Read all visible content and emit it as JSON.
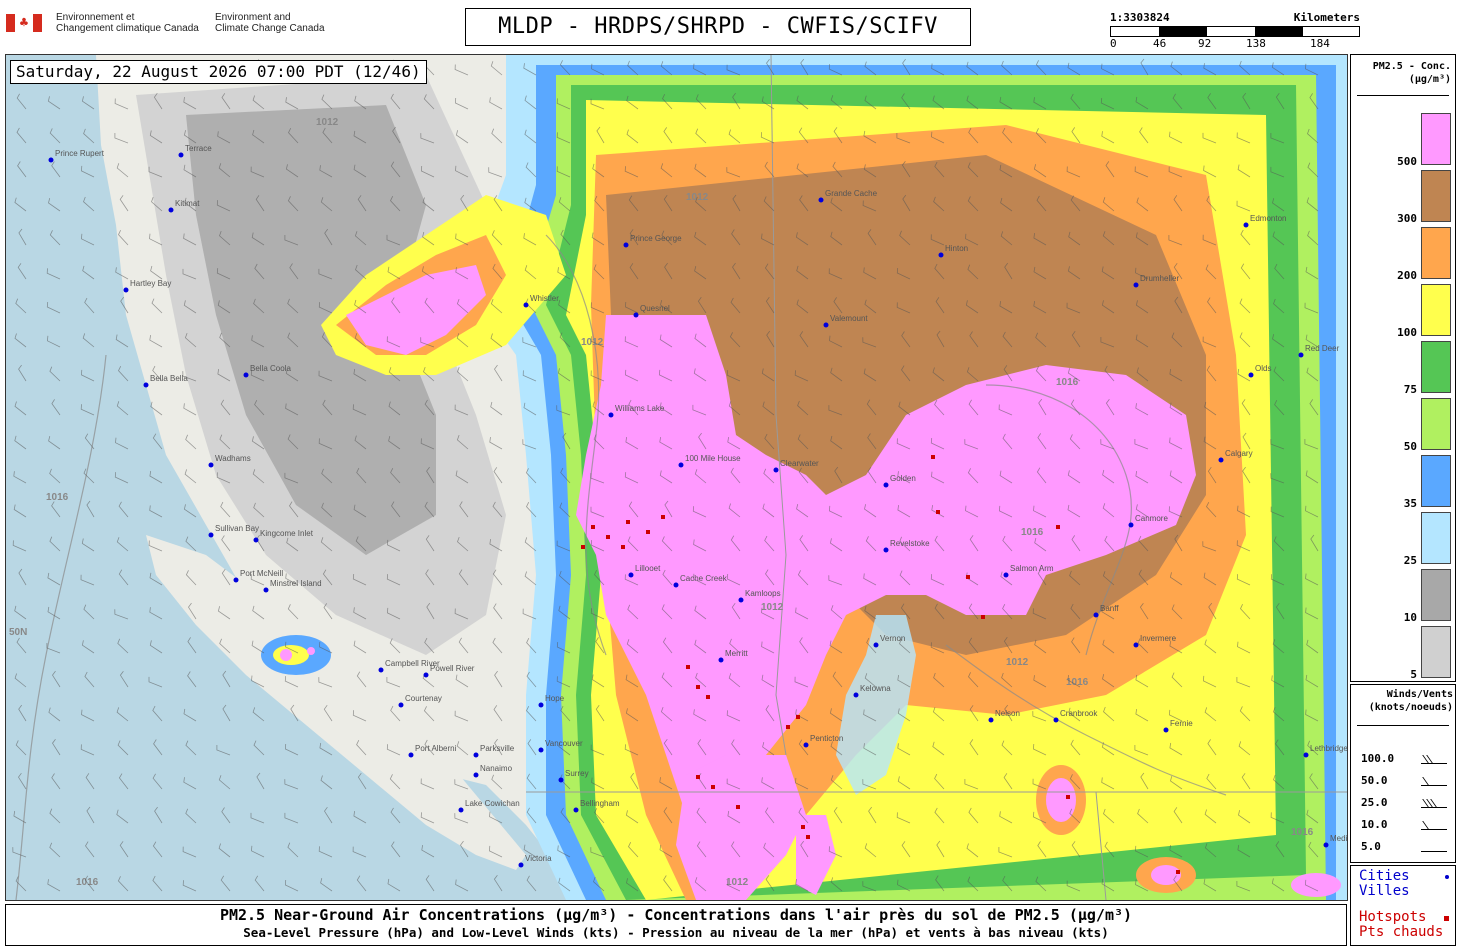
{
  "header": {
    "dept_fr": [
      "Environnement et",
      "Changement climatique Canada"
    ],
    "dept_en": [
      "Environment and",
      "Climate Change Canada"
    ],
    "title": "MLDP - HRDPS/SHRPD - CWFIS/SCIFV"
  },
  "scale": {
    "ratio": "1:3303824",
    "unit": "Kilometers",
    "ticks": [
      "0",
      "46",
      "92",
      "138",
      "184"
    ]
  },
  "map": {
    "timestamp": "Saturday, 22 August 2026 07:00 PDT (12/46)",
    "isobar_labels": [
      "1012",
      "1012",
      "1012",
      "1016",
      "1016",
      "1016",
      "1016",
      "1012",
      "1012",
      "1016",
      "1016",
      "1012"
    ],
    "lat_label": "50N",
    "cities": [
      "Prince Rupert",
      "Terrace",
      "Kitimat",
      "Hartley Bay",
      "Bella Bella",
      "Bella Coola",
      "Wadhams",
      "Port McNeill",
      "Campbell River",
      "Courtenay",
      "Nanaimo",
      "Lake Cowichan",
      "Victoria",
      "Vancouver",
      "Surrey",
      "Bellingham",
      "Kamloops",
      "Merritt",
      "Cache Creek",
      "Clearwater",
      "Williams Lake",
      "100 Mile House",
      "Valemount",
      "Revelstoke",
      "Nelson",
      "Cranbrook",
      "Fernie",
      "Golden",
      "Canmore",
      "Calgary",
      "Red Deer",
      "Edmonton",
      "Hinton",
      "Grande Cache",
      "Prince George",
      "Quesnel",
      "Lillooet",
      "Hope",
      "Penticton",
      "Kelowna",
      "Vernon",
      "Salmon Arm",
      "Banff",
      "Invermere",
      "Lethbridge",
      "Medicine Hat",
      "Drumheller",
      "Olds",
      "Whistler",
      "Powell River",
      "Parksville",
      "Sullivan Bay",
      "Kingcome Inlet",
      "Minstrel Island",
      "Port Alberni"
    ],
    "hotspots_count": 24
  },
  "legend": {
    "title": [
      "PM2.5 - Conc.",
      "(µg/m³)"
    ],
    "levels": [
      {
        "value": "500",
        "color": "#ff99ff"
      },
      {
        "value": "300",
        "color": "#bf8552"
      },
      {
        "value": "200",
        "color": "#ffa64d"
      },
      {
        "value": "100",
        "color": "#ffff4d"
      },
      {
        "value": "75",
        "color": "#55c655"
      },
      {
        "value": "50",
        "color": "#b0f060"
      },
      {
        "value": "35",
        "color": "#5aa8ff"
      },
      {
        "value": "25",
        "color": "#b4e6ff"
      },
      {
        "value": "10",
        "color": "#a8a8a8"
      },
      {
        "value": "5",
        "color": "#d0d0d0"
      }
    ]
  },
  "winds": {
    "title": [
      "Winds/Vents",
      "(knots/noeuds)"
    ],
    "rows": [
      {
        "speed": "100.0",
        "barbs": 2
      },
      {
        "speed": "50.0",
        "barbs": 1
      },
      {
        "speed": "25.0",
        "barbs": 3
      },
      {
        "speed": "10.0",
        "barbs": 1
      },
      {
        "speed": "5.0",
        "barbs": 0
      }
    ]
  },
  "cities_legend": {
    "cities_en": "Cities",
    "cities_fr": "Villes",
    "hotspots_en": "Hotspots",
    "hotspots_fr": "Pts chauds"
  },
  "caption": {
    "line1": "PM2.5 Near-Ground Air Concentrations (µg/m³) - Concentrations dans l'air près du sol de PM2.5 (µg/m³)",
    "line2": "Sea-Level Pressure (hPa) and Low-Level Winds (kts) - Pression au niveau de la mer (hPa) et vents à bas niveau (kts)"
  },
  "colors": {
    "ocean": "#b9d7e4",
    "land": "#ecece6",
    "city_dot": "#0000dd",
    "hotspot": "#cc0000"
  }
}
